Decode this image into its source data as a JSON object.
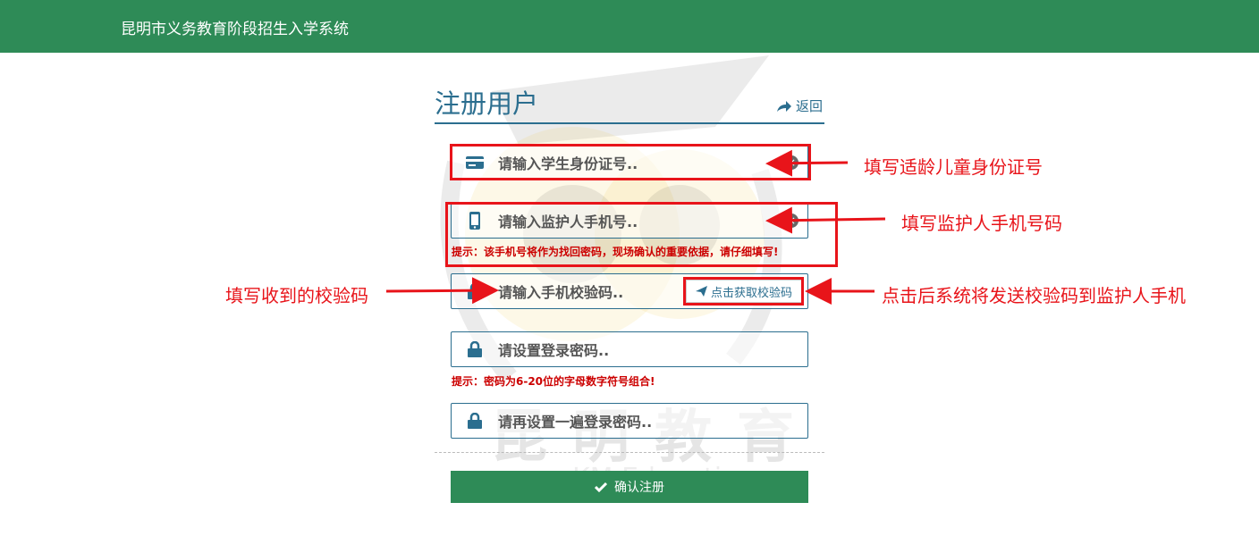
{
  "header": {
    "app_title": "昆明市义务教育阶段招生入学系统"
  },
  "form": {
    "title": "注册用户",
    "back_label": "返回",
    "id_placeholder": "请输入学生身份证号..",
    "phone_placeholder": "请输入监护人手机号..",
    "phone_hint": "提示：该手机号将作为找回密码，现场确认的重要依据，请仔细填写!",
    "code_placeholder": "请输入手机校验码..",
    "get_code_label": "点击获取校验码",
    "password_placeholder": "请设置登录密码..",
    "password_hint": "提示：密码为6-20位的字母数字符号组合!",
    "confirm_placeholder": "请再设置一遍登录密码..",
    "submit_label": "确认注册"
  },
  "watermark": {
    "cn": "昆明教育",
    "en": "KM Education"
  },
  "annotations": {
    "id": "填写适龄儿童身份证号",
    "phone": "填写监护人手机号码",
    "code": "填写收到的校验码",
    "send": "点击后系统将发送校验码到监护人手机"
  },
  "colors": {
    "header": "#2e8b57",
    "accent": "#2b6e8f",
    "annotation": "#e8141a",
    "hint": "#cc0000"
  },
  "icons": [
    "id-card-icon",
    "phone-icon",
    "lock-icon",
    "send-icon",
    "share-arrow-icon",
    "check-icon",
    "clear-icon"
  ]
}
